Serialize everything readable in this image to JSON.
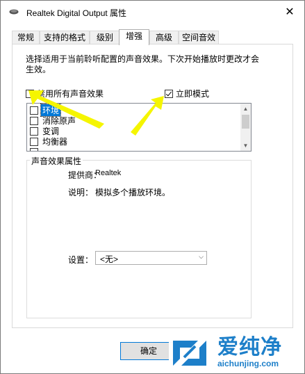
{
  "window": {
    "title": "Realtek Digital Output 属性",
    "icon": "speaker-icon",
    "close_glyph": "✕"
  },
  "tabs": [
    {
      "label": "常规",
      "active": false
    },
    {
      "label": "支持的格式",
      "active": false
    },
    {
      "label": "级别",
      "active": false
    },
    {
      "label": "增强",
      "active": true
    },
    {
      "label": "高级",
      "active": false
    },
    {
      "label": "空间音效",
      "active": false
    }
  ],
  "enhancements": {
    "description": "选择适用于当前聆听配置的声音效果。下次开始播放时更改才会生效。",
    "disable_all": {
      "label": "禁用所有声音效果",
      "checked": false
    },
    "immediate_mode": {
      "label": "立即模式",
      "checked": true
    },
    "effects": [
      {
        "label": "环境",
        "checked": false,
        "selected": true
      },
      {
        "label": "消除原声",
        "checked": false,
        "selected": false
      },
      {
        "label": "变调",
        "checked": false,
        "selected": false
      },
      {
        "label": "均衡器",
        "checked": false,
        "selected": false
      },
      {
        "label": "",
        "checked": false,
        "selected": false
      }
    ]
  },
  "properties": {
    "group_title": "声音效果属性",
    "provider_label": "提供商：",
    "provider_value": "Realtek",
    "description_label": "说明：",
    "description_value": "模拟多个播放环境。",
    "setting_label": "设置：",
    "setting_value": "<无>"
  },
  "footer": {
    "ok_label": "确定"
  },
  "watermark": {
    "brand": "爱纯净",
    "url": "aichunjing.com",
    "color": "#1d7fc9"
  },
  "annotation": {
    "arrow_color": "#f5f500"
  }
}
